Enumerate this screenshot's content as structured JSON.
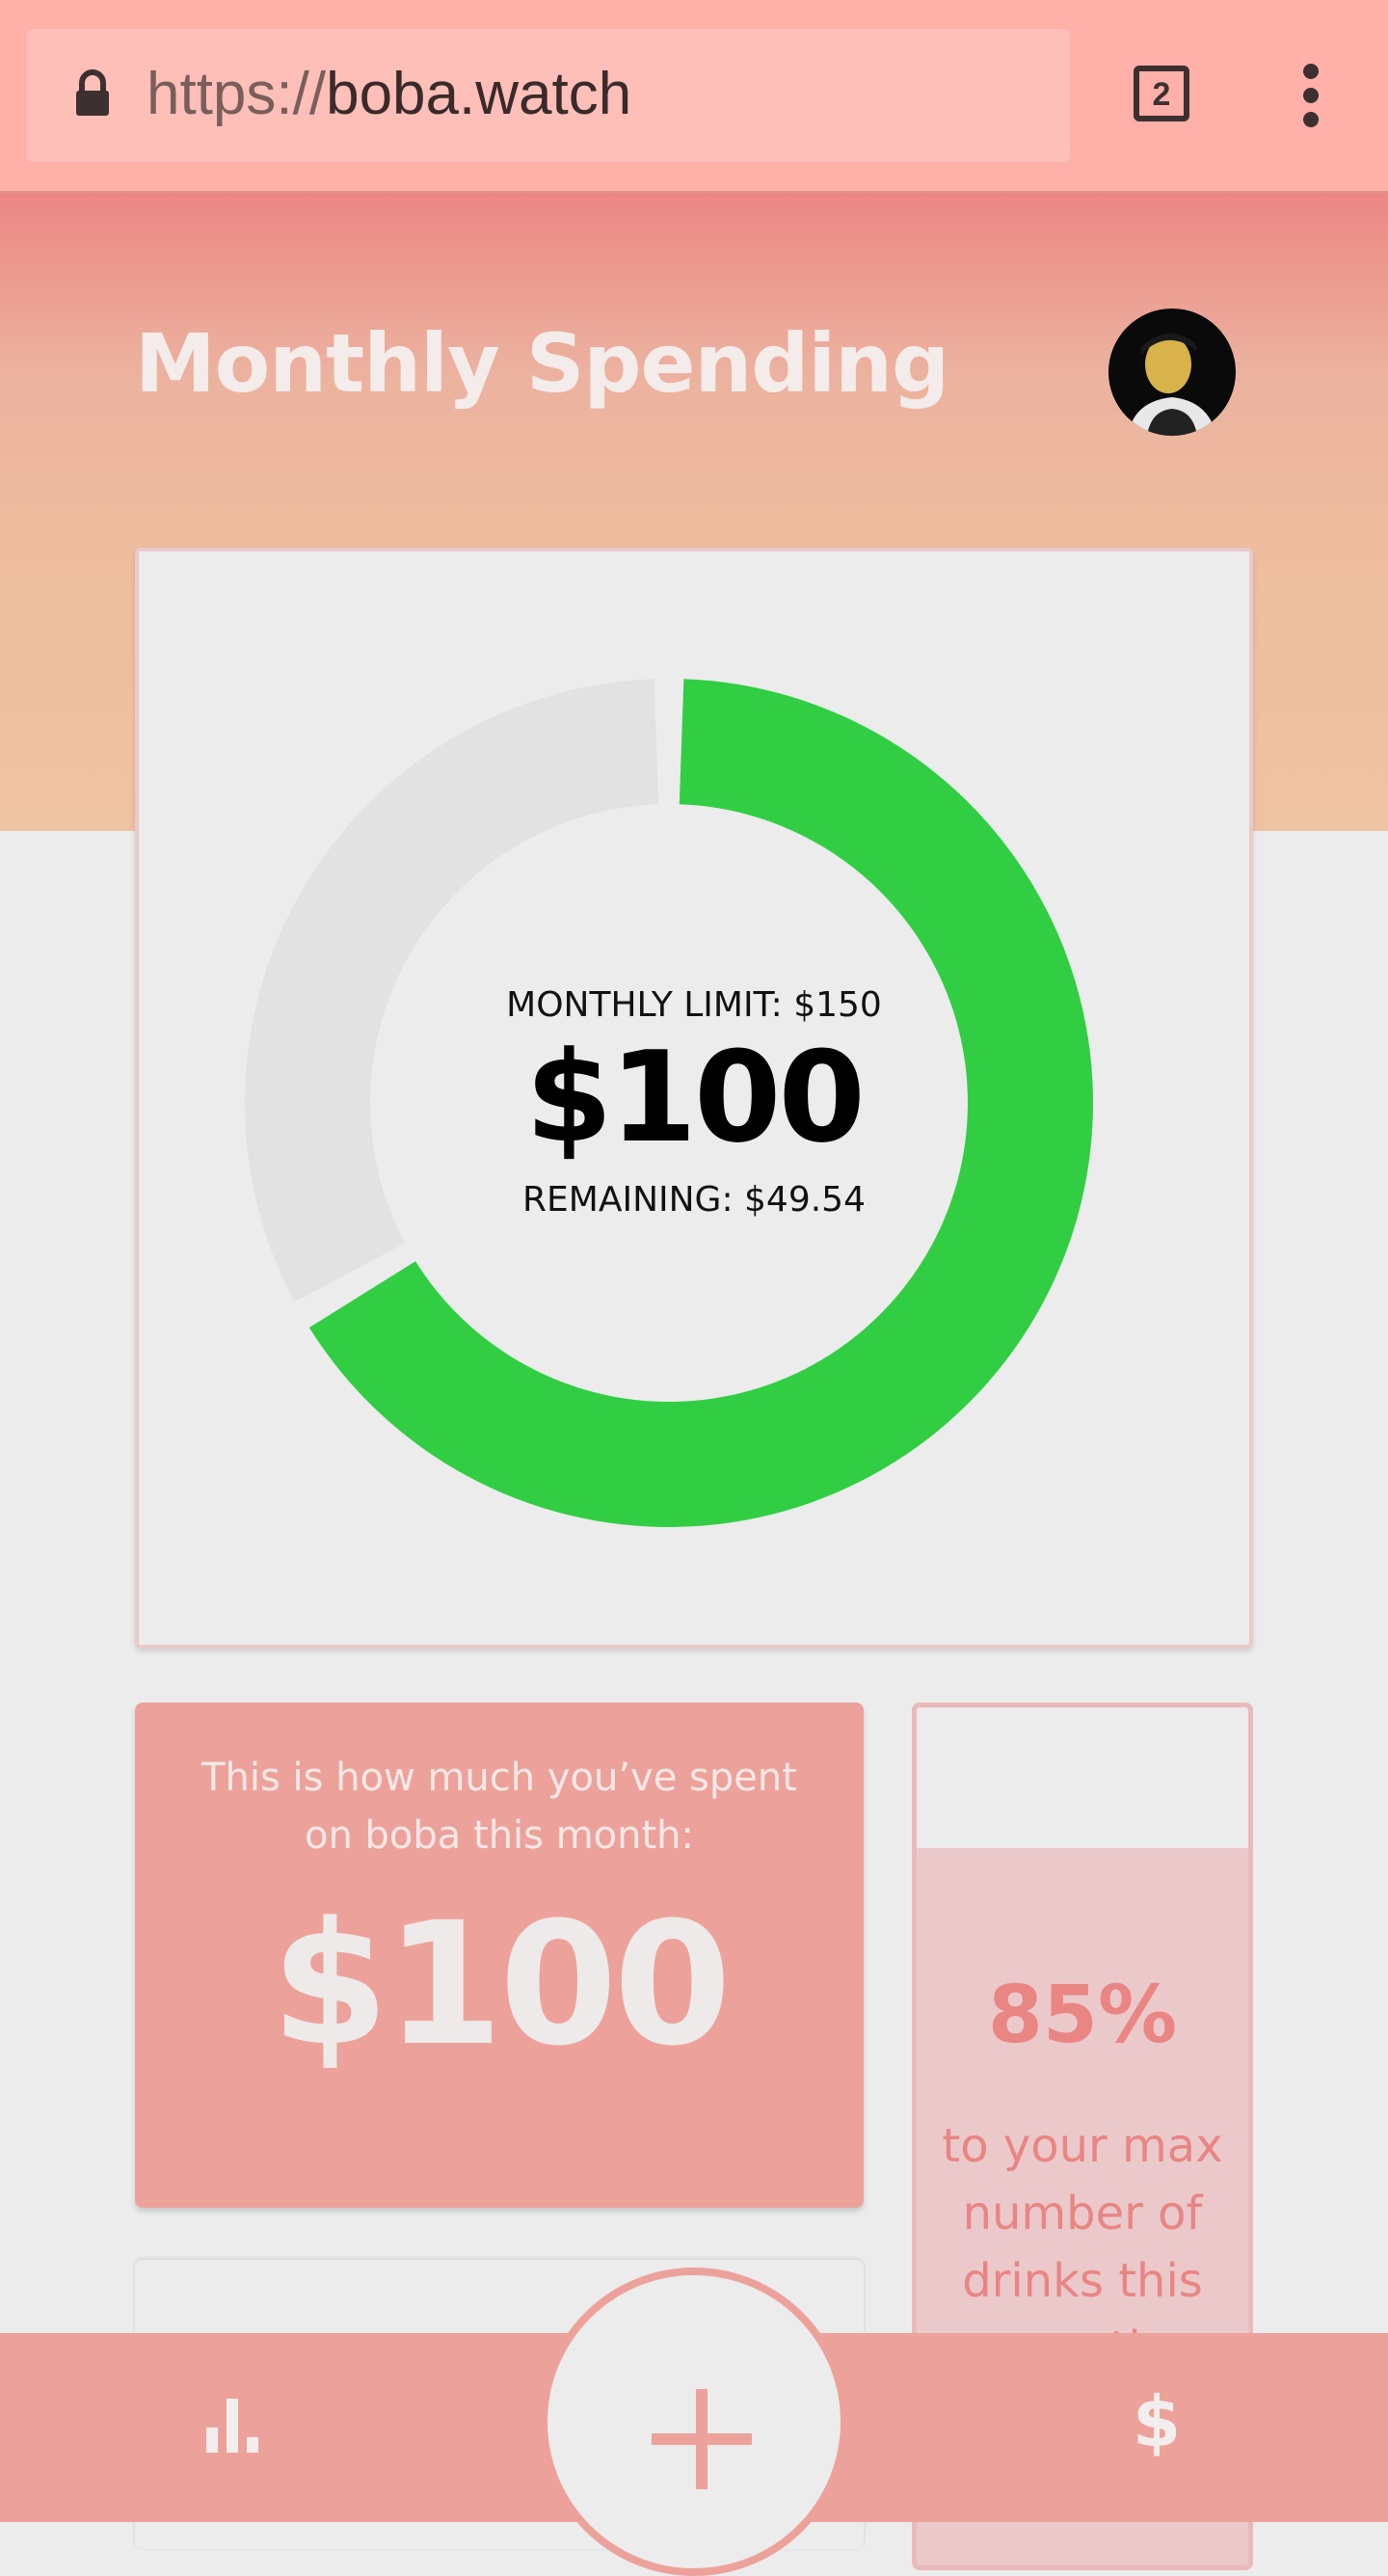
{
  "browser": {
    "url_scheme": "https://",
    "url_host": "boba.watch",
    "tab_count": "2",
    "icons": [
      "lock-icon",
      "tabs-icon",
      "overflow-menu-icon"
    ]
  },
  "header": {
    "title": "Monthly Spending",
    "avatar": "user-avatar"
  },
  "chart_data": {
    "type": "donut",
    "spent": 100,
    "monthly_limit": 150,
    "spent_fraction": 0.6667,
    "limit_label": "MONTHLY LIMIT: $150",
    "center_value": "$100",
    "remaining_label": "REMAINING: $49.54",
    "colors": {
      "spent": "#31ce43",
      "remaining": "#e2e2e2"
    }
  },
  "spent_card": {
    "label": "This is how much you’ve spent on boba this month:",
    "value": "$100"
  },
  "drinks_card": {
    "percent": "85%",
    "text": "to your max number of drinks this month"
  },
  "bottom_nav": {
    "stats_icon": "bar-chart-icon",
    "add_icon": "plus-icon",
    "dollar_label": "$"
  },
  "colors": {
    "accent": "#eca29b",
    "accent_text": "#e98583",
    "chrome": "#ffb0a9",
    "donut_green": "#31ce43"
  }
}
